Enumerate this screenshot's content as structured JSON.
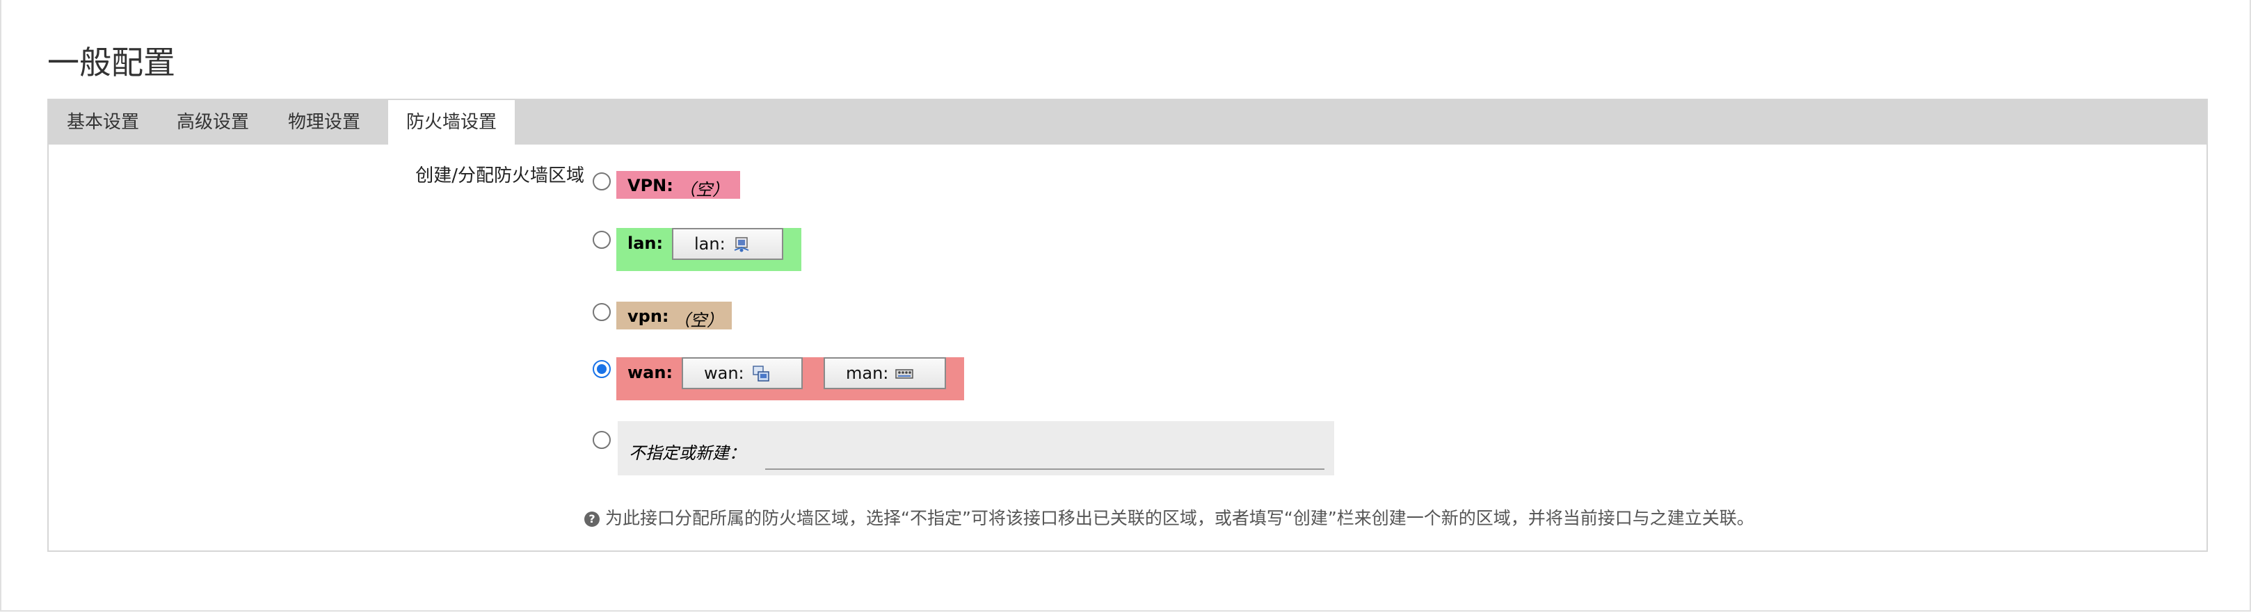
{
  "page": {
    "title": "一般配置"
  },
  "tabs": [
    {
      "label": "基本设置",
      "active": false
    },
    {
      "label": "高级设置",
      "active": false
    },
    {
      "label": "物理设置",
      "active": false
    },
    {
      "label": "防火墙设置",
      "active": true
    }
  ],
  "firewall": {
    "field_label": "创建/分配防火墙区域",
    "zones": [
      {
        "name": "VPN:",
        "empty_text": "（空）",
        "color": "#f08ca4",
        "selected": false,
        "interfaces": []
      },
      {
        "name": "lan:",
        "color": "#90ee90",
        "selected": false,
        "interfaces": [
          {
            "label": "lan:",
            "icon": "ethernet-icon"
          }
        ]
      },
      {
        "name": "vpn:",
        "empty_text": "（空）",
        "color": "#d8bc9c",
        "selected": false,
        "interfaces": []
      },
      {
        "name": "wan:",
        "color": "#f08c8c",
        "selected": true,
        "interfaces": [
          {
            "label": "wan:",
            "icon": "network-icon"
          },
          {
            "label": "man:",
            "icon": "switch-icon"
          }
        ]
      }
    ],
    "new_zone": {
      "label": "不指定或新建：",
      "value": "",
      "selected": false
    },
    "help_text": "为此接口分配所属的防火墙区域，选择“不指定”可将该接口移出已关联的区域，或者填写“创建”栏来创建一个新的区域，并将当前接口与之建立关联。"
  }
}
